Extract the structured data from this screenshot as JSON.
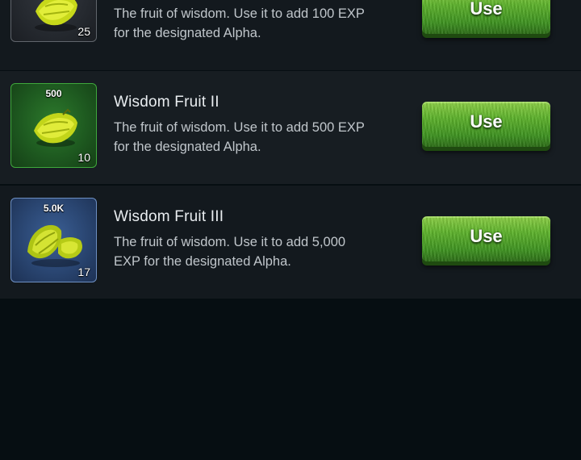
{
  "items": [
    {
      "name": "",
      "value_badge": "",
      "count": "25",
      "description_line1": "The fruit of wisdom. Use it to add 100 EXP",
      "description_line2": "for the designated Alpha.",
      "button_label": "Use",
      "icon": "star-fruit-icon",
      "rarity_color": "#5f646b"
    },
    {
      "name": "Wisdom Fruit II",
      "value_badge": "500",
      "count": "10",
      "description_line1": "The fruit of wisdom. Use it to add 500 EXP",
      "description_line2": "for the designated Alpha.",
      "button_label": "Use",
      "icon": "star-fruit-icon",
      "rarity_color": "#3fa83c"
    },
    {
      "name": "Wisdom Fruit III",
      "value_badge": "5.0K",
      "count": "17",
      "description_line1": "The fruit of wisdom. Use it to add 5,000",
      "description_line2": "EXP for the designated Alpha.",
      "button_label": "Use",
      "icon": "star-fruit-pair-icon",
      "rarity_color": "#6d8fc2"
    }
  ],
  "colors": {
    "background": "#060e12",
    "row_background": "#171d22",
    "button_green": "#5fb52c",
    "title_text": "#e9edf0",
    "body_text": "#c0c6cb"
  }
}
